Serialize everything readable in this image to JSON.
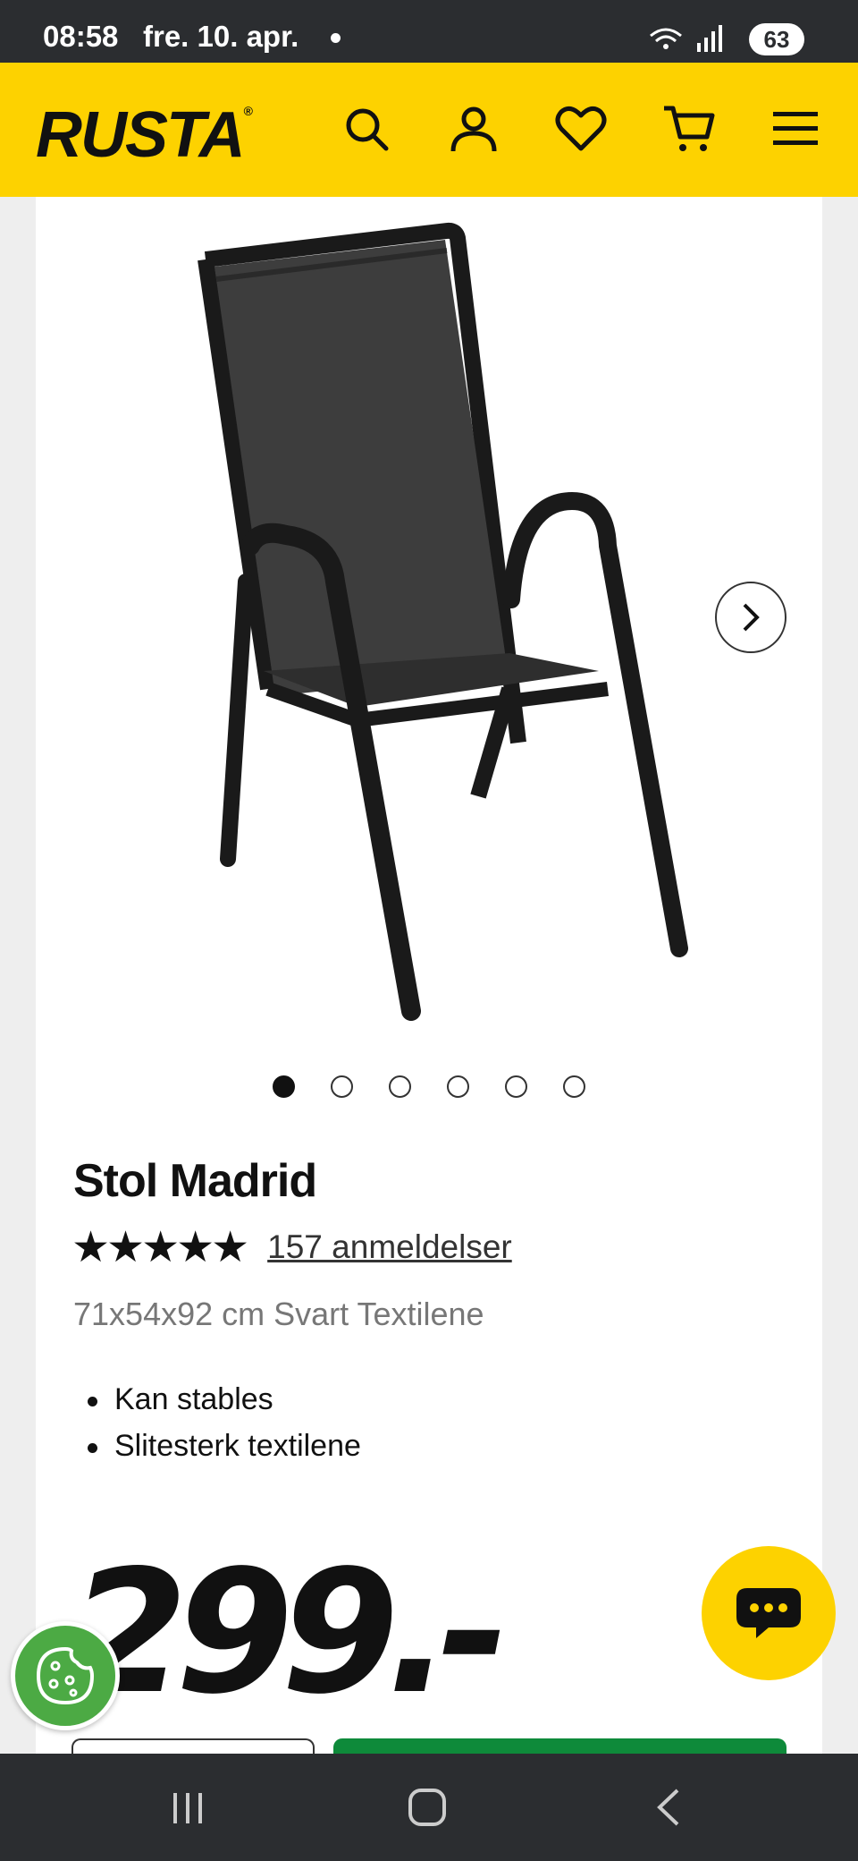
{
  "status_bar": {
    "time": "08:58",
    "date": "fre. 10. apr.",
    "battery": "63"
  },
  "header": {
    "logo": "RUSTA",
    "icons": [
      "search-icon",
      "account-icon",
      "heart-icon",
      "cart-icon",
      "menu-icon"
    ],
    "background": "#fdd200"
  },
  "gallery": {
    "image_count": 6,
    "active_index": 1
  },
  "product": {
    "title": "Stol Madrid",
    "rating_stars": "★★★★★",
    "rating": 4.8,
    "reviews": "157 anmeldelser",
    "subtitle": "71x54x92 cm Svart Textilene",
    "features": [
      "Kan stables",
      "Slitesterk textilene"
    ],
    "price": "299.-"
  },
  "colors": {
    "accent": "#fdd200",
    "buy": "#0e8a3a",
    "cookie": "#4caa44"
  }
}
